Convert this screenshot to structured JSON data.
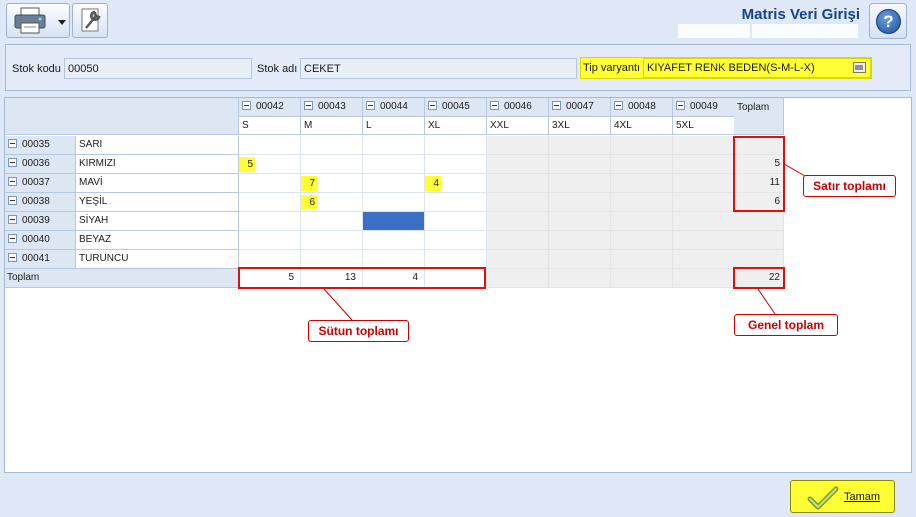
{
  "window": {
    "title": "Matris Veri Girişi"
  },
  "toolbar": {
    "print_icon": "printer-icon",
    "dropdown_icon": "chevron-down-icon",
    "settings_icon": "wrench-icon",
    "help_icon": "help-icon"
  },
  "filter": {
    "stock_code_label": "Stok kodu",
    "stock_code_value": "00050",
    "stock_name_label": "Stok adı",
    "stock_name_value": "CEKET",
    "variant_label": "Tip varyantı",
    "variant_value": "KIYAFET RENK BEDEN(S-M-L-X)"
  },
  "grid": {
    "columns": [
      {
        "code": "00042",
        "size": "S"
      },
      {
        "code": "00043",
        "size": "M"
      },
      {
        "code": "00044",
        "size": "L"
      },
      {
        "code": "00045",
        "size": "XL"
      },
      {
        "code": "00046",
        "size": "XXL"
      },
      {
        "code": "00047",
        "size": "3XL"
      },
      {
        "code": "00048",
        "size": "4XL"
      },
      {
        "code": "00049",
        "size": "5XL"
      }
    ],
    "total_header": "Toplam",
    "rows": [
      {
        "code": "00035",
        "name": "SARI",
        "values": [
          "",
          "",
          "",
          "",
          "",
          "",
          "",
          ""
        ],
        "total": ""
      },
      {
        "code": "00036",
        "name": "KIRMIZI",
        "values": [
          "5",
          "",
          "",
          "",
          "",
          "",
          "",
          ""
        ],
        "total": "5"
      },
      {
        "code": "00037",
        "name": "MAVİ",
        "values": [
          "",
          "7",
          "",
          "4",
          "",
          "",
          "",
          ""
        ],
        "total": "11"
      },
      {
        "code": "00038",
        "name": "YEŞİL",
        "values": [
          "",
          "6",
          "",
          "",
          "",
          "",
          "",
          ""
        ],
        "total": "6"
      },
      {
        "code": "00039",
        "name": "SİYAH",
        "values": [
          "",
          "",
          "",
          "",
          "",
          "",
          "",
          ""
        ],
        "total": ""
      },
      {
        "code": "00040",
        "name": "BEYAZ",
        "values": [
          "",
          "",
          "",
          "",
          "",
          "",
          "",
          ""
        ],
        "total": ""
      },
      {
        "code": "00041",
        "name": "TURUNCU",
        "values": [
          "",
          "",
          "",
          "",
          "",
          "",
          "",
          ""
        ],
        "total": ""
      }
    ],
    "footer": {
      "label": "Toplam",
      "values": [
        "5",
        "13",
        "4",
        "",
        "",
        "",
        "",
        ""
      ],
      "grand_total": "22"
    }
  },
  "annotations": {
    "row_total": "Satır toplamı",
    "column_total": "Sütun toplamı",
    "grand_total": "Genel toplam"
  },
  "ok_button": {
    "label": "Tamam",
    "icon": "checkmark-icon"
  },
  "colors": {
    "highlight": "#ffff33",
    "selected": "#3a6fc4",
    "annotation": "#e01010",
    "title": "#15428b"
  }
}
